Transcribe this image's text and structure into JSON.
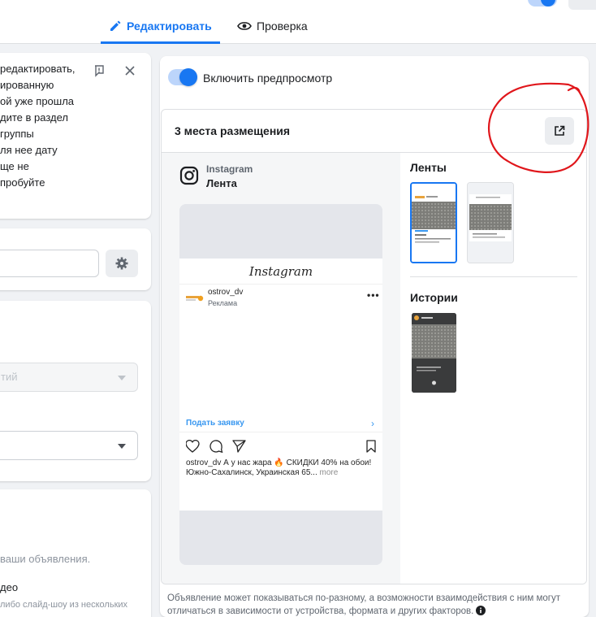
{
  "header": {
    "tabs": [
      {
        "label": "Редактировать",
        "active": true
      },
      {
        "label": "Проверка",
        "active": false
      }
    ]
  },
  "left": {
    "notice_lines": [
      "редактировать,",
      "ированную",
      "ой уже прошла",
      "дите в раздел",
      "группы",
      "ля нее дату",
      "ще не",
      "пробуйте"
    ],
    "select1_value": "тий",
    "format_desc": "ваши объявления.",
    "format_video": "део",
    "format_slides": "либо слайд-шоу из нескольких"
  },
  "preview": {
    "toggle_label": "Включить предпросмотр",
    "toggle_on": true,
    "placements_title": "3 места размещения",
    "platform": "Instagram",
    "placement": "Лента",
    "ig_wordmark": "Instagram",
    "account_name": "ostrov_dv",
    "sponsored": "Реклама",
    "cta_label": "Подать заявку",
    "caption_line1": "ostrov_dv А у нас жара 🔥 СКИДКИ 40% на обои!",
    "caption_line2": "Южно-Сахалинск, Украинская 65...",
    "caption_more": "more",
    "feeds_label": "Ленты",
    "stories_label": "Истории",
    "disclaimer": "Объявление может показываться по-разному, а возможности взаимодействия с ним могут отличаться в зависимости от устройства, формата и других факторов."
  },
  "colors": {
    "accent": "#1877f2",
    "annotation": "#e0161b",
    "link": "#3897f0"
  },
  "icons": [
    "pencil-icon",
    "eye-icon",
    "flag-icon",
    "close-icon",
    "gear-icon",
    "external-link-icon",
    "instagram-icon",
    "heart-icon",
    "comment-icon",
    "send-icon",
    "bookmark-icon",
    "info-icon"
  ]
}
